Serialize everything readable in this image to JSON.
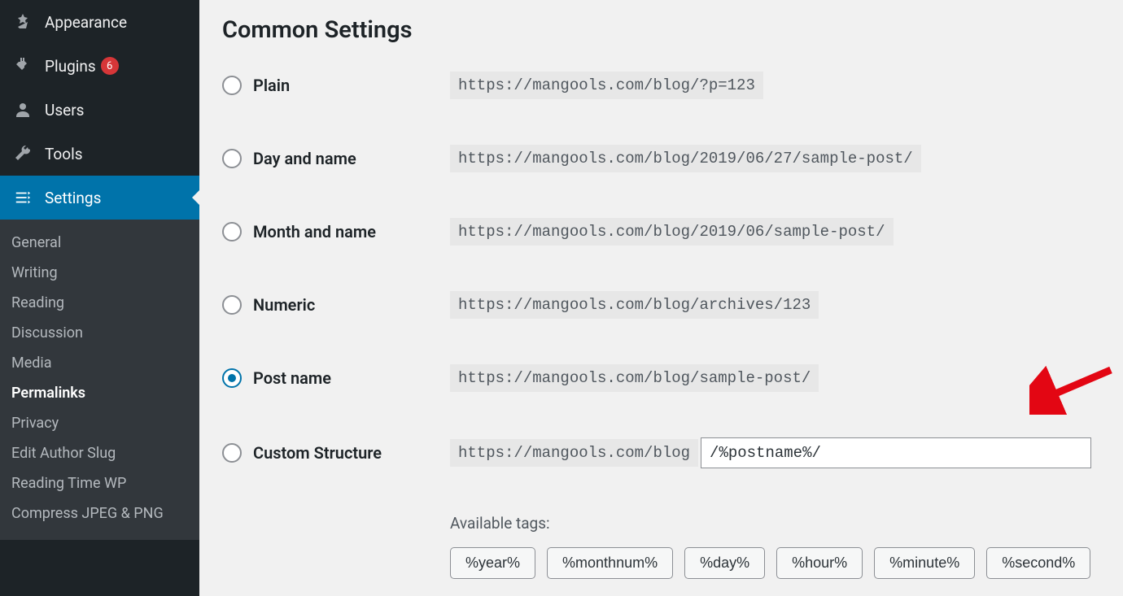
{
  "sidebar": {
    "main_items": [
      {
        "icon": "appearance-icon",
        "label": "Appearance"
      },
      {
        "icon": "plugins-icon",
        "label": "Plugins",
        "badge": "6"
      },
      {
        "icon": "users-icon",
        "label": "Users"
      },
      {
        "icon": "tools-icon",
        "label": "Tools"
      },
      {
        "icon": "settings-icon",
        "label": "Settings",
        "active": true
      }
    ],
    "submenu": [
      {
        "label": "General"
      },
      {
        "label": "Writing"
      },
      {
        "label": "Reading"
      },
      {
        "label": "Discussion"
      },
      {
        "label": "Media"
      },
      {
        "label": "Permalinks",
        "current": true
      },
      {
        "label": "Privacy"
      },
      {
        "label": "Edit Author Slug"
      },
      {
        "label": "Reading Time WP"
      },
      {
        "label": "Compress JPEG & PNG"
      }
    ]
  },
  "main": {
    "title": "Common Settings",
    "options": [
      {
        "label": "Plain",
        "example": "https://mangools.com/blog/?p=123",
        "selected": false
      },
      {
        "label": "Day and name",
        "example": "https://mangools.com/blog/2019/06/27/sample-post/",
        "selected": false
      },
      {
        "label": "Month and name",
        "example": "https://mangools.com/blog/2019/06/sample-post/",
        "selected": false
      },
      {
        "label": "Numeric",
        "example": "https://mangools.com/blog/archives/123",
        "selected": false
      },
      {
        "label": "Post name",
        "example": "https://mangools.com/blog/sample-post/",
        "selected": true
      },
      {
        "label": "Custom Structure",
        "example": "https://mangools.com/blog",
        "selected": false,
        "custom": true,
        "value": "/%postname%/"
      }
    ],
    "available_tags_label": "Available tags:",
    "tags": [
      "%year%",
      "%monthnum%",
      "%day%",
      "%hour%",
      "%minute%",
      "%second%"
    ]
  }
}
